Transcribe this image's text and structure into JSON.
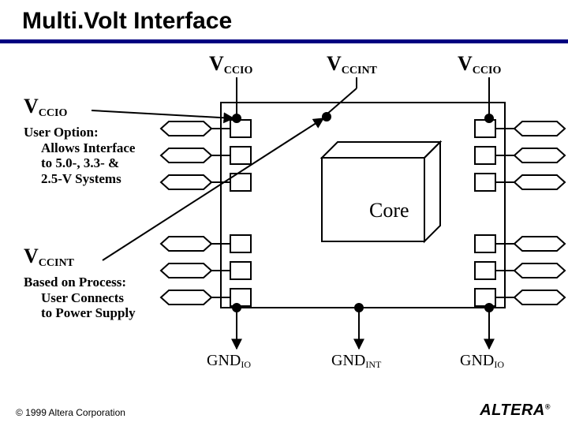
{
  "title": "Multi.Volt Interface",
  "topLabels": {
    "left": {
      "base": "V",
      "sub": "CCIO"
    },
    "mid": {
      "base": "V",
      "sub": "CCINT"
    },
    "right": {
      "base": "V",
      "sub": "CCIO"
    }
  },
  "sideVccio": {
    "base": "V",
    "sub": "CCIO"
  },
  "vccioDesc": {
    "line1": "User Option:",
    "line2": "Allows Interface",
    "line3": "to 5.0-, 3.3- &",
    "line4": "2.5-V Systems"
  },
  "sideVccint": {
    "base": "V",
    "sub": "CCINT"
  },
  "vccintDesc": {
    "line1": "Based on Process:",
    "line2": "User Connects",
    "line3": "to Power Supply"
  },
  "coreLabel": "Core",
  "bottomLabels": {
    "left": {
      "base": "GND",
      "sub": "IO"
    },
    "mid": {
      "base": "GND",
      "sub": "INT"
    },
    "right": {
      "base": "GND",
      "sub": "IO"
    }
  },
  "footer": "© 1999 Altera Corporation",
  "logo": "ALTERA"
}
